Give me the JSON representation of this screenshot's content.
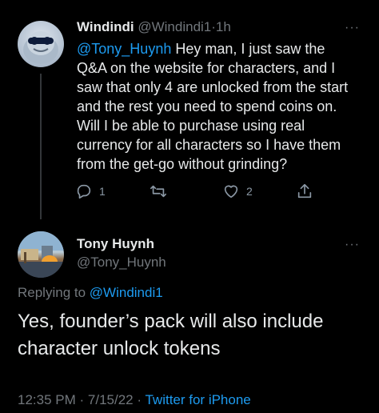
{
  "reply_tweet": {
    "display_name": "Windindi",
    "handle": "@Windindi1",
    "separator": "·",
    "time": "1h",
    "more": "···",
    "mention": "@Tony_Huynh",
    "body": " Hey man, I just saw the Q&A on the website for characters, and I saw that only 4 are unlocked from the start and the rest you need to spend coins on. Will I be able to purchase using real currency for all characters so I have them from the get-go without grinding?",
    "reply_count": "1",
    "retweet_count": "",
    "like_count": "2",
    "icons": [
      "reply-icon",
      "retweet-icon",
      "like-icon",
      "share-icon"
    ]
  },
  "main_tweet": {
    "display_name": "Tony Huynh",
    "handle": "@Tony_Huynh",
    "more": "···",
    "replying_prefix": "Replying to ",
    "replying_to": "@Windindi1",
    "body": "Yes, founder’s pack will also include character unlock tokens",
    "time": "12:35 PM",
    "sep1": "·",
    "date": "7/15/22",
    "sep2": "·",
    "source": "Twitter for iPhone"
  },
  "colors": {
    "background": "#000000",
    "text": "#e7e9ea",
    "muted": "#71767b",
    "accent": "#1d9bf0"
  }
}
